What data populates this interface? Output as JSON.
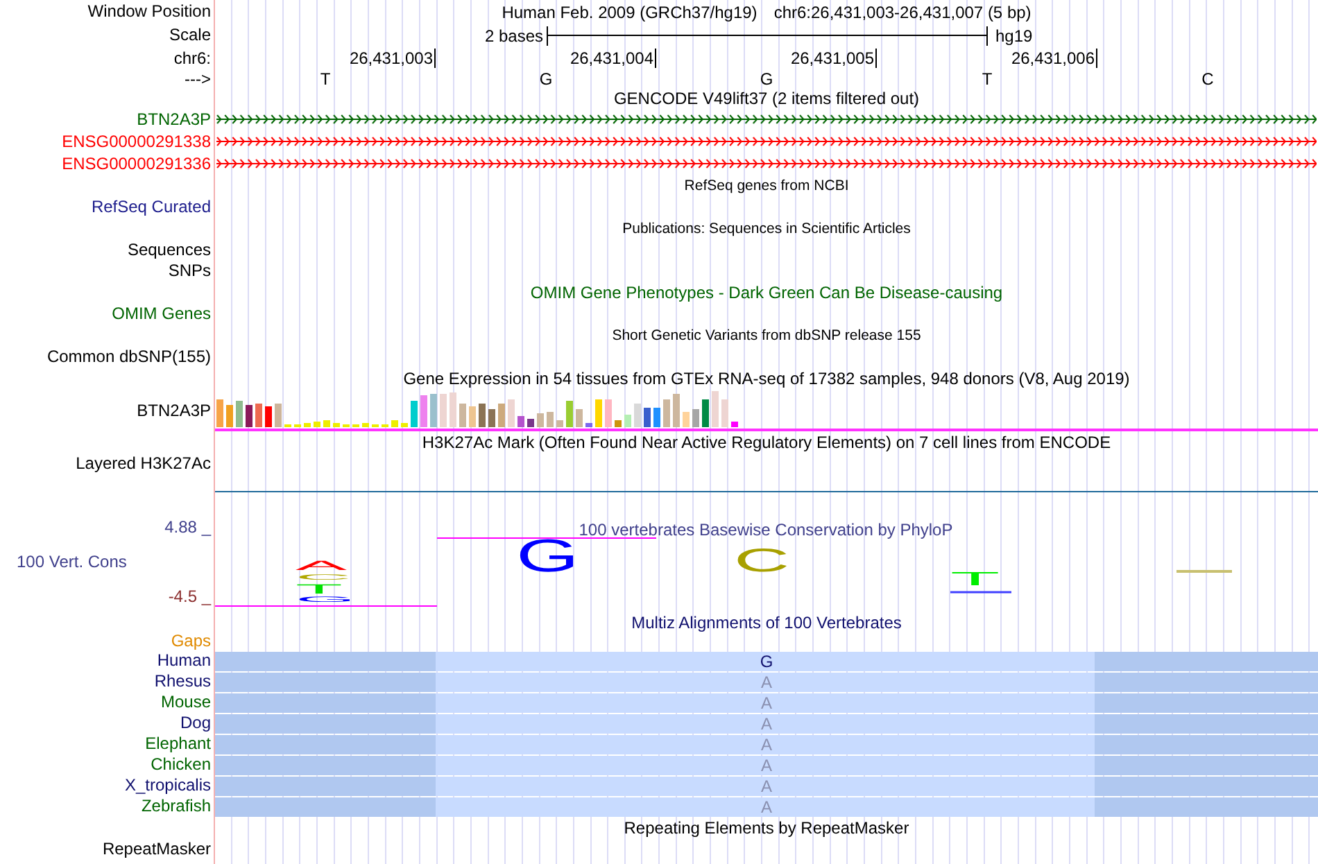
{
  "header": {
    "label": "Window Position",
    "assembly": "Human Feb. 2009 (GRCh37/hg19)",
    "position": "chr6:26,431,003-26,431,007 (5 bp)"
  },
  "scale": {
    "label": "Scale",
    "length": "2 bases",
    "assembly": "hg19"
  },
  "ruler": {
    "label": "chr6:",
    "ticks": [
      "26,431,003",
      "26,431,004",
      "26,431,005",
      "26,431,006"
    ]
  },
  "bases": {
    "label": "--->",
    "letters": [
      "T",
      "G",
      "G",
      "T",
      "C"
    ]
  },
  "tracks": [
    {
      "kind": "genes",
      "title": "GENCODE V49lift37 (2 items filtered out)",
      "genes": [
        {
          "name": "BTN2A3P",
          "color": "#006400"
        },
        {
          "name": "ENSG00000291338",
          "color": "#ff0000"
        },
        {
          "name": "ENSG00000291336",
          "color": "#ff0000"
        }
      ]
    },
    {
      "kind": "compact",
      "title": "RefSeq genes from NCBI",
      "labels": [
        {
          "text": "RefSeq Curated",
          "color": "#1c1c8c"
        }
      ]
    },
    {
      "kind": "compact",
      "title": "Publications: Sequences in Scientific Articles",
      "labels": [
        {
          "text": "Sequences",
          "color": "#000000"
        },
        {
          "text": "SNPs",
          "color": "#000000"
        }
      ]
    },
    {
      "kind": "full",
      "title": "OMIM Gene Phenotypes - Dark Green Can Be Disease-causing",
      "color": "#006400",
      "labels": [
        {
          "text": "OMIM Genes",
          "color": "#006400"
        }
      ]
    },
    {
      "kind": "compact",
      "title": "Short Genetic Variants from dbSNP release 155",
      "labels": [
        {
          "text": "Common dbSNP(155)",
          "color": "#000000"
        }
      ]
    },
    {
      "kind": "expression",
      "title": "Gene Expression in 54 tissues from GTEx RNA-seq of 17382 samples, 948 donors (V8, Aug 2019)",
      "labels": [
        {
          "text": "BTN2A3P",
          "color": "#000000"
        }
      ]
    },
    {
      "kind": "layered",
      "title": "H3K27Ac Mark (Often Found Near Active Regulatory Elements) on 7 cell lines from ENCODE",
      "labels": [
        {
          "text": "Layered H3K27Ac",
          "color": "#000000"
        }
      ]
    },
    {
      "kind": "conservation",
      "title": "100 vertebrates Basewise Conservation by PhyloP",
      "labels": [
        {
          "text": "100 Vert. Cons",
          "color": "#40408c"
        }
      ],
      "ymax": "4.88 _",
      "ymin": "-4.5 _",
      "logos": [
        {
          "letters": [
            {
              "base": "A",
              "color": "#ff0000"
            },
            {
              "base": "C",
              "color": "#b0a800"
            },
            {
              "base": "T",
              "color": "#00e000"
            },
            {
              "base": "G",
              "color": "#0000ff"
            }
          ]
        },
        {
          "letters": [
            {
              "base": "G",
              "color": "#0000ff"
            }
          ]
        },
        {
          "letters": [
            {
              "base": "C",
              "color": "#a8a000"
            }
          ]
        },
        {
          "letters": [
            {
              "base": "T",
              "color": "#00ee00"
            }
          ]
        }
      ]
    },
    {
      "kind": "alignment",
      "title": "Multiz Alignments of 100 Vertebrates",
      "gaps_label": "Gaps",
      "species": [
        {
          "name": "Human",
          "color": "#10106e",
          "base": "G",
          "reference": true
        },
        {
          "name": "Rhesus",
          "color": "#10106e",
          "base": "A",
          "reference": false
        },
        {
          "name": "Mouse",
          "color": "#006400",
          "base": "A",
          "reference": false
        },
        {
          "name": "Dog",
          "color": "#10106e",
          "base": "A",
          "reference": false
        },
        {
          "name": "Elephant",
          "color": "#006400",
          "base": "A",
          "reference": false
        },
        {
          "name": "Chicken",
          "color": "#006400",
          "base": "A",
          "reference": false
        },
        {
          "name": "X_tropicalis",
          "color": "#10106e",
          "base": "A",
          "reference": false
        },
        {
          "name": "Zebrafish",
          "color": "#006400",
          "base": "A",
          "reference": false
        }
      ]
    },
    {
      "kind": "full",
      "title": "Repeating Elements by RepeatMasker",
      "labels": [
        {
          "text": "RepeatMasker",
          "color": "#000000"
        }
      ]
    }
  ]
}
